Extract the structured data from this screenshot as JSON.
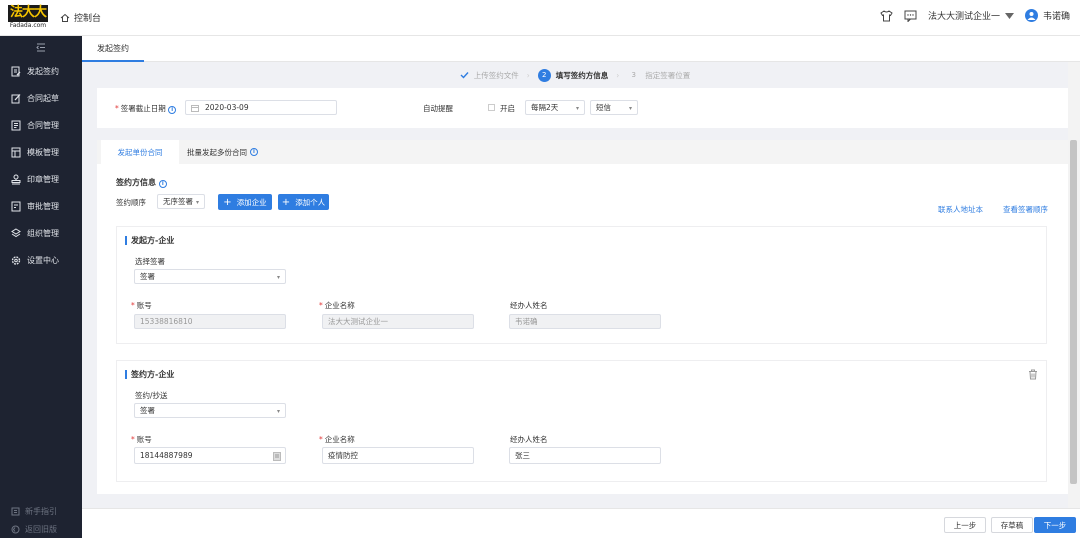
{
  "app": {
    "logo_text": "法大大",
    "logo_sub": "Fadada.com",
    "home_label": "控制台"
  },
  "header": {
    "company": "法大大测试企业一",
    "user": "韦诺确"
  },
  "sidebar": {
    "items": [
      {
        "label": "发起签约",
        "icon": "sign-doc-icon"
      },
      {
        "label": "合同起草",
        "icon": "edit-icon"
      },
      {
        "label": "合同管理",
        "icon": "doc-list-icon"
      },
      {
        "label": "模板管理",
        "icon": "template-icon"
      },
      {
        "label": "印章管理",
        "icon": "stamp-icon"
      },
      {
        "label": "审批管理",
        "icon": "approval-icon"
      },
      {
        "label": "组织管理",
        "icon": "layers-icon"
      },
      {
        "label": "设置中心",
        "icon": "gear-icon"
      }
    ],
    "bottom": [
      {
        "label": "新手指引",
        "icon": "guide-icon"
      },
      {
        "label": "返回旧版",
        "icon": "back-icon"
      }
    ]
  },
  "page_tab": "发起签约",
  "steps": [
    {
      "num": "",
      "label": "上传签约文件",
      "state": "done"
    },
    {
      "num": "2",
      "label": "填写签约方信息",
      "state": "active"
    },
    {
      "num": "3",
      "label": "指定签署位置",
      "state": "todo"
    }
  ],
  "deadline": {
    "label": "签署截止日期",
    "value": "2020-03-09"
  },
  "reminder": {
    "label": "自动提醒",
    "checkbox_label": "开启",
    "frequency": "每隔2天",
    "channel": "短信"
  },
  "subtabs": [
    {
      "label": "发起单份合同"
    },
    {
      "label": "批量发起多份合同"
    }
  ],
  "signers": {
    "title": "签约方信息",
    "order_label": "签约顺序",
    "order_value": "无序签署",
    "add_company": "添加企业",
    "add_person": "添加个人",
    "link_contacts": "联系人地址本",
    "link_order": "查看签署顺序"
  },
  "initiator": {
    "title": "发起方-企业",
    "select_label": "选择签署",
    "select_value": "签署",
    "account_label": "账号",
    "account_value": "15338816810",
    "company_label": "企业名称",
    "company_value": "法大大测试企业一",
    "handler_label": "经办人姓名",
    "handler_value": "韦诺确"
  },
  "signer": {
    "title": "签约方-企业",
    "select_label": "签约/抄送",
    "select_value": "签署",
    "account_label": "账号",
    "account_value": "18144887989",
    "company_label": "企业名称",
    "company_value": "疫情防控",
    "handler_label": "经办人姓名",
    "handler_value": "张三"
  },
  "footer": {
    "prev": "上一步",
    "save": "存草稿",
    "next": "下一步"
  }
}
